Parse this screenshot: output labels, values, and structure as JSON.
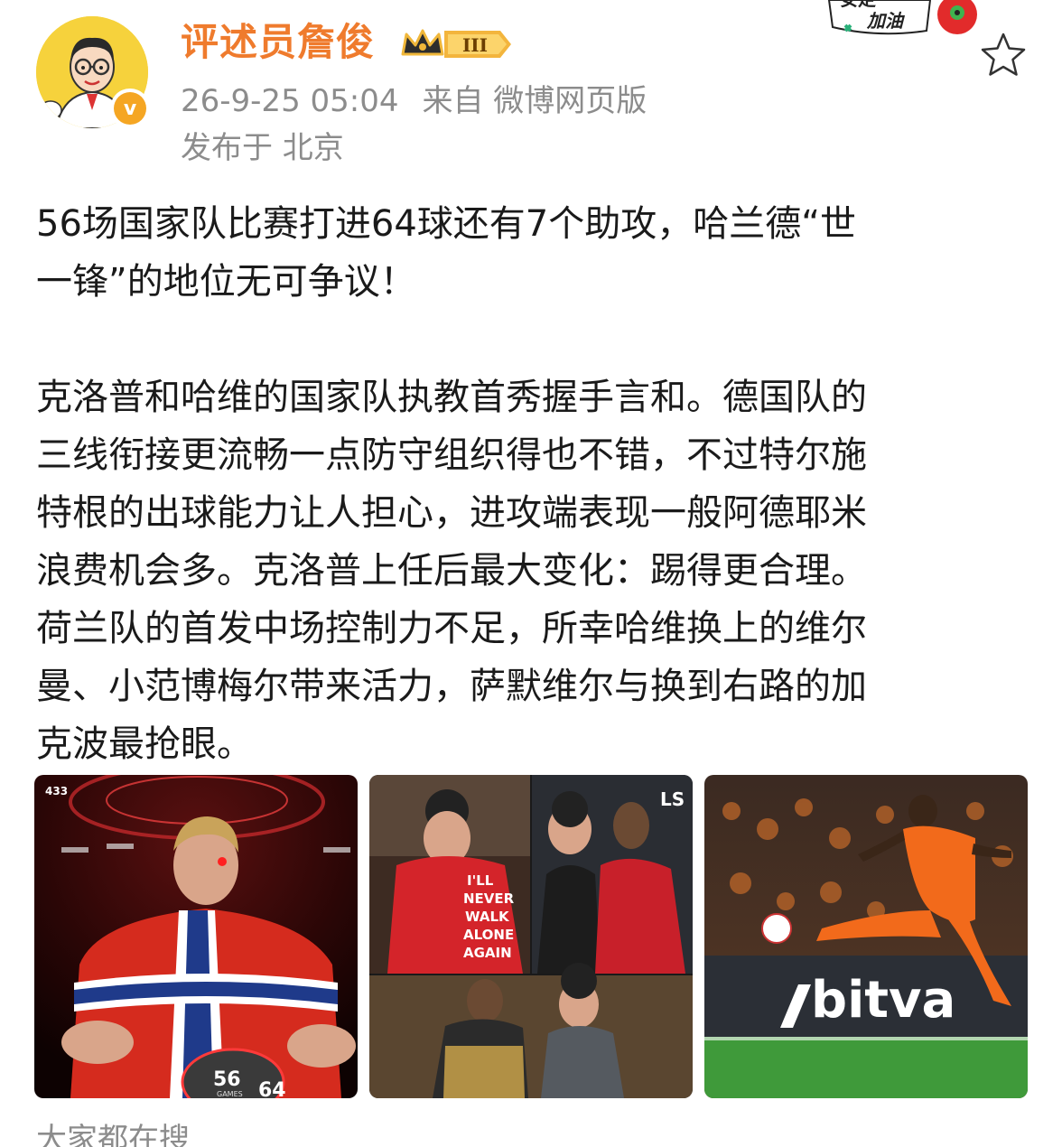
{
  "post": {
    "author": {
      "name": "评述员詹俊",
      "level": "III",
      "verified_mark": "v"
    },
    "meta": {
      "time": "26-9-25 05:04",
      "source": "来自 微博网页版",
      "location": "发布于 北京"
    },
    "sticker": {
      "text": "加油",
      "partial_text": "安定"
    },
    "text": {
      "paragraph1": "56场国家队比赛打进64球还有7个助攻，哈兰德“世\n一锋”的地位无可争议！",
      "paragraph2": "克洛普和哈维的国家队执教首秀握手言和。德国队的\n三线衔接更流畅一点防守组织得也不错，不过特尔施\n特根的出球能力让人担心，进攻端表现一般阿德耶米\n浪费机会多。克洛普上任后最大变化：踢得更合理。\n荷兰队的首发中场控制力不足，所幸哈维换上的维尔\n曼、小范博梅尔带来活力，萨默维尔与换到右路的加\n克波最抢眼。"
    },
    "images": [
      {
        "watermark": "433",
        "shirt_numbers": [
          "56",
          "64"
        ],
        "caption_small": "GAMES"
      },
      {
        "watermark": "LS",
        "shirt_text": [
          "I'LL",
          "NEVER",
          "WALK",
          "ALONE",
          "AGAIN"
        ]
      },
      {
        "board_text": "bitva"
      }
    ],
    "footer": "大家都在搜"
  },
  "colors": {
    "username": "#ef7b2d",
    "meta": "#8c8c8c",
    "text": "#1a1a1a",
    "badge_gold": "#f5a623"
  },
  "icons": {
    "favorite": "star-outline-icon",
    "verified": "verified-v-icon",
    "level": "crown-level-icon"
  }
}
